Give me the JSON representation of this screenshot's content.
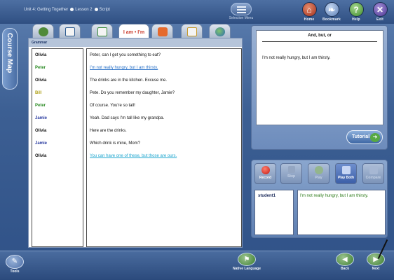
{
  "header": {
    "crumb_unit": "Unit 4: Getting Together",
    "crumb_lesson": "Lesson 2",
    "crumb_section": "Script",
    "selection_menu_label": "Selection Menu",
    "home_label": "Home",
    "bookmark_label": "Bookmark",
    "help_label": "Help",
    "exit_label": "Exit"
  },
  "sidebar": {
    "course_map_label": "Course Map"
  },
  "tabs": {
    "active_label": "I am • I'm"
  },
  "script": {
    "section_label": "Grammar",
    "rows": [
      {
        "speaker": "Olivia",
        "line": "Peter, can I get you something to eat?",
        "speaker_color": "#111111",
        "line_color": "#111111",
        "link": false
      },
      {
        "speaker": "Peter",
        "line": "I'm not really hungry, but I am thirsty.",
        "speaker_color": "#2a8a23",
        "line_color": "#2a72c8",
        "link": true
      },
      {
        "speaker": "Olivia",
        "line": "The drinks are in the kitchen.  Excuse me.",
        "speaker_color": "#111111",
        "line_color": "#111111",
        "link": false
      },
      {
        "speaker": "Bill",
        "line": "Pete.  Do you remember my daughter, Jamie?",
        "speaker_color": "#b0a21a",
        "line_color": "#111111",
        "link": false
      },
      {
        "speaker": "Peter",
        "line": "Of course.  You're so tall!",
        "speaker_color": "#2a8a23",
        "line_color": "#111111",
        "link": false
      },
      {
        "speaker": "Jamie",
        "line": "Yeah.  Dad says I'm tall like my grandpa.",
        "speaker_color": "#2a3ca0",
        "line_color": "#111111",
        "link": false
      },
      {
        "speaker": "Olivia",
        "line": "Here are the drinks.",
        "speaker_color": "#111111",
        "line_color": "#111111",
        "link": false
      },
      {
        "speaker": "Jamie",
        "line": "Which drink is mine, Mom?",
        "speaker_color": "#2a3ca0",
        "line_color": "#111111",
        "link": false
      },
      {
        "speaker": "Olivia",
        "line": "You can have one of these, but those are ours.",
        "speaker_color": "#111111",
        "line_color": "#1ea6cf",
        "link": true
      }
    ]
  },
  "translation": {
    "title": "And, but, or",
    "text": "I'm not really hungry, but I am thirsty.",
    "tutorial_label": "Tutorial"
  },
  "recorder": {
    "record_label": "Record",
    "stop_label": "Stop",
    "play_label": "Play",
    "play_both_label": "Play Both",
    "compare_label": "Compare",
    "student_name": "student1",
    "response_text": "I'm not really hungry, but I am thirsty."
  },
  "footer": {
    "tools_label": "Tools",
    "native_language_label": "Native Language",
    "back_label": "Back",
    "next_label": "Next"
  }
}
